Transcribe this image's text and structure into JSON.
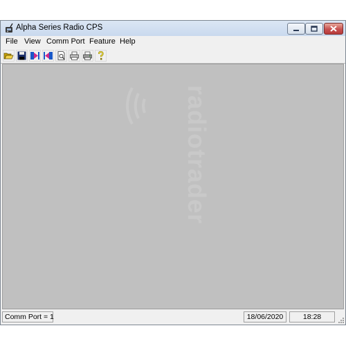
{
  "window": {
    "title": "Alpha Series Radio CPS",
    "app_icon": "radio-app-icon"
  },
  "caption_buttons": [
    "minimize",
    "maximize",
    "close"
  ],
  "menu": [
    "File",
    "View",
    "Comm Port",
    "Feature",
    "Help"
  ],
  "toolbar": [
    {
      "name": "open-icon"
    },
    {
      "name": "save-icon"
    },
    {
      "name": "read-from-radio-icon"
    },
    {
      "name": "write-to-radio-icon"
    },
    {
      "name": "print-preview-icon"
    },
    {
      "name": "print-icon"
    },
    {
      "name": "print-setup-icon"
    },
    {
      "name": "help-icon"
    }
  ],
  "watermark": "radiotrader",
  "status": {
    "comm_port": "Comm Port = 1",
    "date": "18/06/2020",
    "time": "18:28"
  },
  "colors": {
    "client_bg": "#c0c0c0",
    "chrome_bg": "#f0f0f0",
    "close_button": "#c75050"
  }
}
